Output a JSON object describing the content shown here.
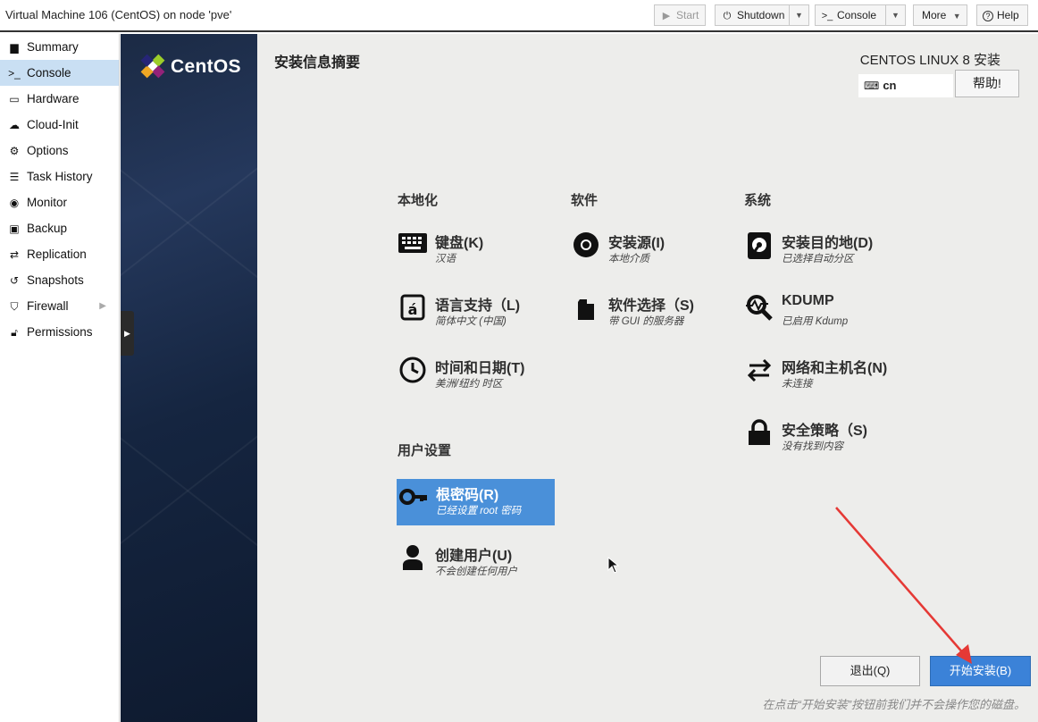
{
  "window": {
    "title": "Virtual Machine 106 (CentOS) on node 'pve'"
  },
  "toolbar": {
    "start": "Start",
    "shutdown": "Shutdown",
    "console": "Console",
    "more": "More",
    "help": "Help"
  },
  "sidebar": {
    "items": [
      {
        "label": "Summary",
        "icon": "book-icon"
      },
      {
        "label": "Console",
        "icon": "terminal-icon"
      },
      {
        "label": "Hardware",
        "icon": "monitor-icon"
      },
      {
        "label": "Cloud-Init",
        "icon": "cloud-icon"
      },
      {
        "label": "Options",
        "icon": "gear-icon"
      },
      {
        "label": "Task History",
        "icon": "list-icon"
      },
      {
        "label": "Monitor",
        "icon": "eye-icon"
      },
      {
        "label": "Backup",
        "icon": "floppy-icon"
      },
      {
        "label": "Replication",
        "icon": "retweet-icon"
      },
      {
        "label": "Snapshots",
        "icon": "history-icon"
      },
      {
        "label": "Firewall",
        "icon": "shield-icon"
      },
      {
        "label": "Permissions",
        "icon": "unlock-icon"
      }
    ]
  },
  "installer": {
    "logo_text": "CentOS",
    "page_title": "安装信息摘要",
    "product_title": "CENTOS LINUX 8 安装",
    "keyboard_layout": "cn",
    "help_button": "帮助!",
    "sections": {
      "localization": "本地化",
      "software": "软件",
      "system": "系统",
      "user_settings": "用户设置"
    },
    "spokes": {
      "keyboard": {
        "title": "键盘(K)",
        "status": "汉语"
      },
      "language": {
        "title": "语言支持（L)",
        "status": "简体中文 (中国)"
      },
      "time": {
        "title": "时间和日期(T)",
        "status": "美洲/纽约 时区"
      },
      "source": {
        "title": "安装源(I)",
        "status": "本地介质"
      },
      "software": {
        "title": "软件选择（S)",
        "status": "带 GUI 的服务器"
      },
      "destination": {
        "title": "安装目的地(D)",
        "status": "已选择自动分区"
      },
      "kdump": {
        "title": "KDUMP",
        "status": "已启用 Kdump"
      },
      "network": {
        "title": "网络和主机名(N)",
        "status": "未连接"
      },
      "security": {
        "title": "安全策略（S)",
        "status": "没有找到内容"
      },
      "root": {
        "title": "根密码(R)",
        "status": "已经设置 root 密码"
      },
      "user": {
        "title": "创建用户(U)",
        "status": "不会创建任何用户"
      }
    },
    "quit_button": "退出(Q)",
    "begin_button": "开始安装(B)",
    "warning": "在点击“开始安装”按钮前我们并不会操作您的磁盘。"
  },
  "colors": {
    "accent": "#4a90d9",
    "begin_button": "#3b82d8",
    "sidebar_active": "#c9dff3",
    "annotation_arrow": "#e53935"
  }
}
